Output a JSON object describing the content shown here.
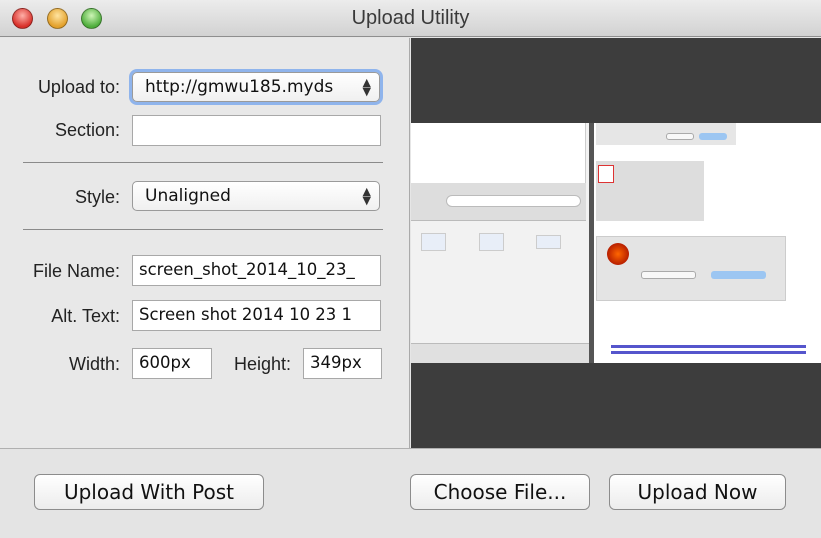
{
  "window": {
    "title": "Upload Utility"
  },
  "form": {
    "upload_to_label": "Upload to:",
    "upload_to_value": "http://gmwu185.myds",
    "section_label": "Section:",
    "section_value": "",
    "style_label": "Style:",
    "style_value": "Unaligned",
    "file_name_label": "File Name:",
    "file_name_value": "screen_shot_2014_10_23_",
    "alt_text_label": "Alt. Text:",
    "alt_text_value": "Screen shot 2014 10 23 1",
    "width_label": "Width:",
    "width_value": "600px",
    "height_label": "Height:",
    "height_value": "349px"
  },
  "buttons": {
    "upload_with_post": "Upload With Post",
    "choose_file": "Choose File...",
    "upload_now": "Upload Now"
  },
  "colors": {
    "close": "#e0443e",
    "minimize": "#e8a93a",
    "zoom": "#5cb94a",
    "focus_ring": "#6a9ee8"
  }
}
